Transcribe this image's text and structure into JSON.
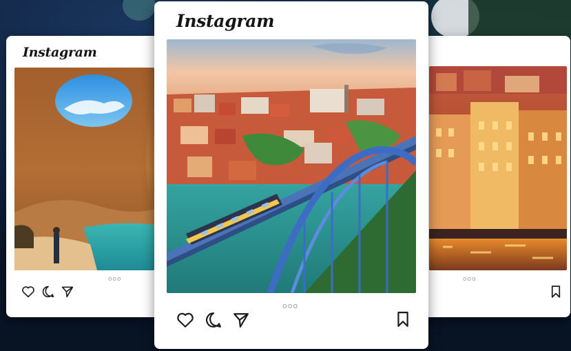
{
  "brand": "Instagram",
  "cards": {
    "left": {
      "logo": "Instagram",
      "photo_subject": "sea cave with opening to sky",
      "dots": "ooo"
    },
    "center": {
      "logo": "Instagram",
      "photo_subject": "bridge with tram over river and old town",
      "dots": "ooo"
    },
    "right": {
      "photo_subject": "colorful riverside houses at dusk",
      "dots": "ooo"
    }
  },
  "icons": [
    "heart-icon",
    "comment-icon",
    "share-icon",
    "bookmark-icon",
    "more-dots-icon"
  ],
  "colors": {
    "background": "#0f2240",
    "card": "#ffffff",
    "icon_stroke": "#1c1c1c",
    "dots": "#9aa0a6"
  }
}
